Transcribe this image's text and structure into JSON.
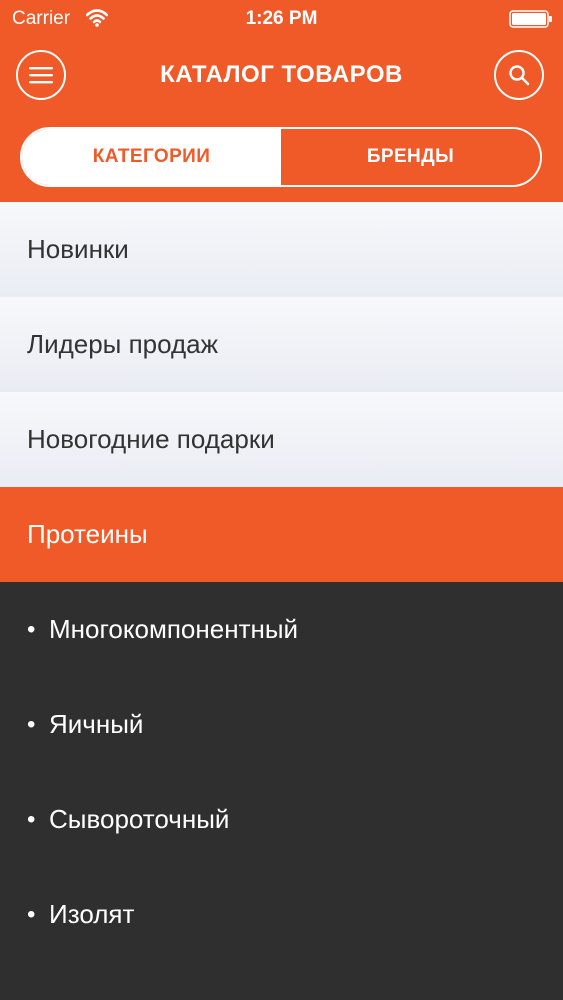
{
  "status_bar": {
    "carrier": "Carrier",
    "time": "1:26 PM"
  },
  "nav": {
    "title": "КАТАЛОГ ТОВАРОВ",
    "menu_icon": "hamburger-menu-icon",
    "search_icon": "search-icon"
  },
  "segments": {
    "categories_label": "КАТЕГОРИИ",
    "brands_label": "БРЕНДЫ",
    "selected": "КАТЕГОРИИ"
  },
  "categories": [
    {
      "label": "Новинки"
    },
    {
      "label": "Лидеры продаж"
    },
    {
      "label": "Новогодние подарки"
    },
    {
      "label": "Протеины",
      "expanded": true
    }
  ],
  "subcategories": [
    {
      "label": "Многокомпонентный"
    },
    {
      "label": "Яичный"
    },
    {
      "label": "Сывороточный"
    },
    {
      "label": "Изолят"
    }
  ],
  "colors": {
    "accent": "#f05a28",
    "list_background": "#f0f2f7",
    "dark_panel": "#2f2f2f"
  }
}
